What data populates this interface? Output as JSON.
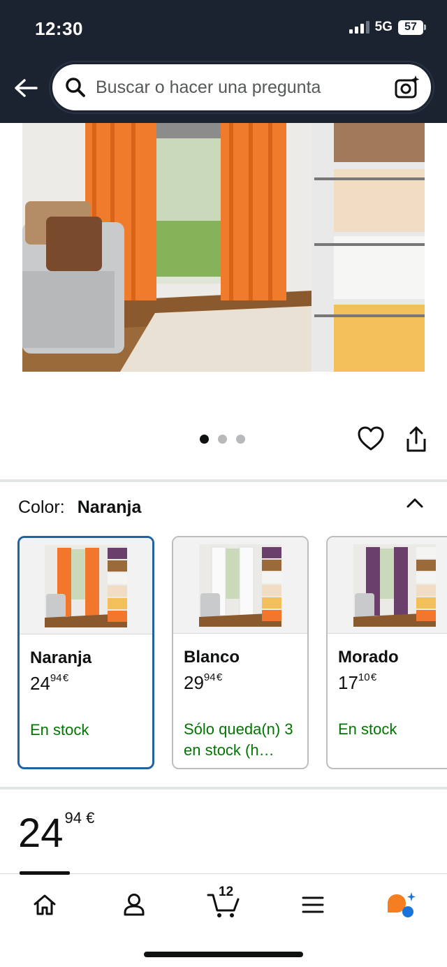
{
  "status_bar": {
    "time": "12:30",
    "network": "5G",
    "battery": "57"
  },
  "search": {
    "placeholder": "Buscar o hacer una pregunta"
  },
  "gallery": {
    "image_count": 3,
    "active_index": 0
  },
  "color_selector": {
    "label": "Color:",
    "selected": "Naranja",
    "options": [
      {
        "name": "Naranja",
        "price_whole": "24",
        "price_fraction": "94",
        "currency": "€",
        "stock": "En stock",
        "accent": "#f2772d"
      },
      {
        "name": "Blanco",
        "price_whole": "29",
        "price_fraction": "94",
        "currency": "€",
        "stock": "Sólo queda(n) 3 en stock (h…",
        "accent": "#f4f4f2"
      },
      {
        "name": "Morado",
        "price_whole": "17",
        "price_fraction": "10",
        "currency": "€",
        "stock": "En stock",
        "accent": "#6b3f6b"
      }
    ]
  },
  "price": {
    "whole": "24",
    "fraction": "94",
    "currency": "€"
  },
  "tabbar": {
    "cart_count": "12",
    "tabs": [
      "home-icon",
      "account-icon",
      "cart-icon",
      "menu-icon",
      "rufus-assistant-icon"
    ]
  },
  "colors": {
    "header_bg": "#1b2230",
    "selected_border": "#2162a1",
    "in_stock": "#007600"
  }
}
